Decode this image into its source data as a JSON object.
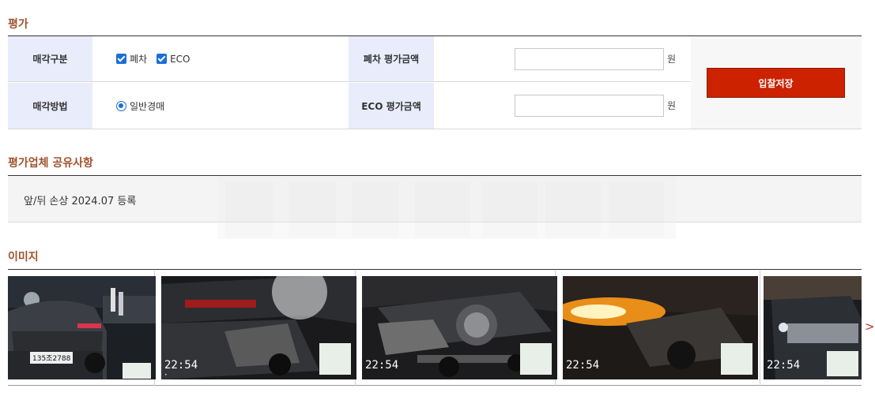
{
  "evaluation": {
    "title": "평가",
    "row1": {
      "label": "매각구분",
      "options": [
        "폐차",
        "ECO"
      ],
      "amount_label": "폐차 평가금액",
      "amount_value": "",
      "unit": "원"
    },
    "row2": {
      "label": "매각방법",
      "option": "일반경매",
      "amount_label": "ECO 평가금액",
      "amount_value": "",
      "unit": "원"
    },
    "save_button": "입찰저장"
  },
  "shared_notes": {
    "title": "평가업체 공유사항",
    "text": "앞/뒤 손상 2024.07 등록"
  },
  "images": {
    "title": "이미지",
    "thumbs": [
      {
        "plate": "135조2788",
        "clock": "",
        "scene": "night-suv-rear"
      },
      {
        "plate": "",
        "clock": "22:54",
        "scene": "damaged-rear-bumper"
      },
      {
        "plate": "",
        "clock": "22:54",
        "scene": "damaged-wheel-side"
      },
      {
        "plate": "",
        "clock": "22:54",
        "scene": "hazard-lights-glare"
      },
      {
        "plate": "",
        "clock": "22:54",
        "scene": "front-suv-night"
      }
    ],
    "next_icon": ">"
  },
  "colors": {
    "accent": "#a0522d",
    "button": "#cc2200",
    "header_cell": "#e9ecfb",
    "check": "#1a6fd8"
  }
}
